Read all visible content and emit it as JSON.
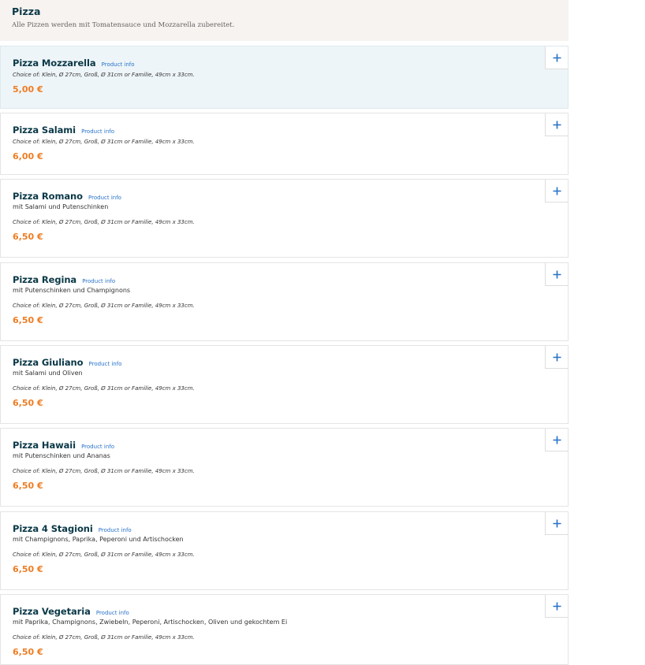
{
  "category": {
    "title": "Pizza",
    "description": "Alle Pizzen werden mit Tomatensauce und Mozzarella zubereitet."
  },
  "product_info_label": "Product info",
  "items": [
    {
      "name": "Pizza Mozzarella",
      "description": "",
      "choice": "Choice of: Klein, Ø 27cm, Groß, Ø 31cm or Familie, 49cm x 33cm.",
      "price": "5,00 €"
    },
    {
      "name": "Pizza Salami",
      "description": "",
      "choice": "Choice of: Klein, Ø 27cm, Groß, Ø 31cm or Familie, 49cm x 33cm.",
      "price": "6,00 €"
    },
    {
      "name": "Pizza Romano",
      "description": "mit Salami und Putenschinken",
      "choice": "Choice of: Klein, Ø 27cm, Groß, Ø 31cm or Familie, 49cm x 33cm.",
      "price": "6,50 €"
    },
    {
      "name": "Pizza Regina",
      "description": "mit Putenschinken und Champignons",
      "choice": "Choice of: Klein, Ø 27cm, Groß, Ø 31cm or Familie, 49cm x 33cm.",
      "price": "6,50 €"
    },
    {
      "name": "Pizza Giuliano",
      "description": "mit Salami und Oliven",
      "choice": "Choice of: Klein, Ø 27cm, Groß, Ø 31cm or Familie, 49cm x 33cm.",
      "price": "6,50 €"
    },
    {
      "name": "Pizza Hawaii",
      "description": "mit Putenschinken und Ananas",
      "choice": "Choice of: Klein, Ø 27cm, Groß, Ø 31cm or Familie, 49cm x 33cm.",
      "price": "6,50 €"
    },
    {
      "name": "Pizza 4 Stagioni",
      "description": "mit Champignons, Paprika, Peperoni und Artischocken",
      "choice": "Choice of: Klein, Ø 27cm, Groß, Ø 31cm or Familie, 49cm x 33cm.",
      "price": "6,50 €"
    },
    {
      "name": "Pizza Vegetaria",
      "description": "mit Paprika, Champignons, Zwiebeln, Peperoni, Artischocken, Oliven und gekochtem Ei",
      "choice": "Choice of: Klein, Ø 27cm, Groß, Ø 31cm or Familie, 49cm x 33cm.",
      "price": "6,50 €"
    }
  ],
  "colors": {
    "title": "#0a3847",
    "link": "#2772c9",
    "price": "#ee7d24",
    "header_bg": "#f7f3f0",
    "selected_bg": "#eef5f8"
  },
  "icons": {
    "add": "plus-icon"
  }
}
